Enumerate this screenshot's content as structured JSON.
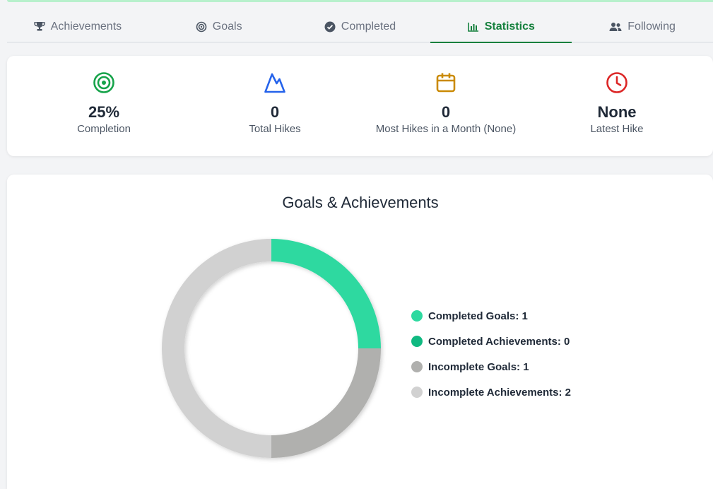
{
  "tabs": [
    {
      "label": "Achievements",
      "icon": "trophy-icon",
      "active": false
    },
    {
      "label": "Goals",
      "icon": "target-icon",
      "active": false
    },
    {
      "label": "Completed",
      "icon": "check-circle-icon",
      "active": false
    },
    {
      "label": "Statistics",
      "icon": "bar-chart-icon",
      "active": true
    },
    {
      "label": "Following",
      "icon": "users-icon",
      "active": false
    }
  ],
  "stats": [
    {
      "value": "25%",
      "label": "Completion",
      "icon": "target-icon",
      "color": "#16a34a"
    },
    {
      "value": "0",
      "label": "Total Hikes",
      "icon": "mountain-icon",
      "color": "#2563eb"
    },
    {
      "value": "0",
      "label": "Most Hikes in a Month (None)",
      "icon": "calendar-icon",
      "color": "#ca8a04"
    },
    {
      "value": "None",
      "label": "Latest Hike",
      "icon": "clock-icon",
      "color": "#dc2626"
    }
  ],
  "chart_data": {
    "type": "pie",
    "title": "Goals & Achievements",
    "categories": [
      "Completed Goals",
      "Completed Achievements",
      "Incomplete Goals",
      "Incomplete Achievements"
    ],
    "values": [
      1,
      0,
      1,
      2
    ],
    "legend_labels": [
      "Completed Goals: 1",
      "Completed Achievements: 0",
      "Incomplete Goals: 1",
      "Incomplete Achievements: 2"
    ],
    "colors": [
      "#2ed9a0",
      "#10b981",
      "#b0b0ae",
      "#d1d1d1"
    ],
    "legend": "right"
  }
}
